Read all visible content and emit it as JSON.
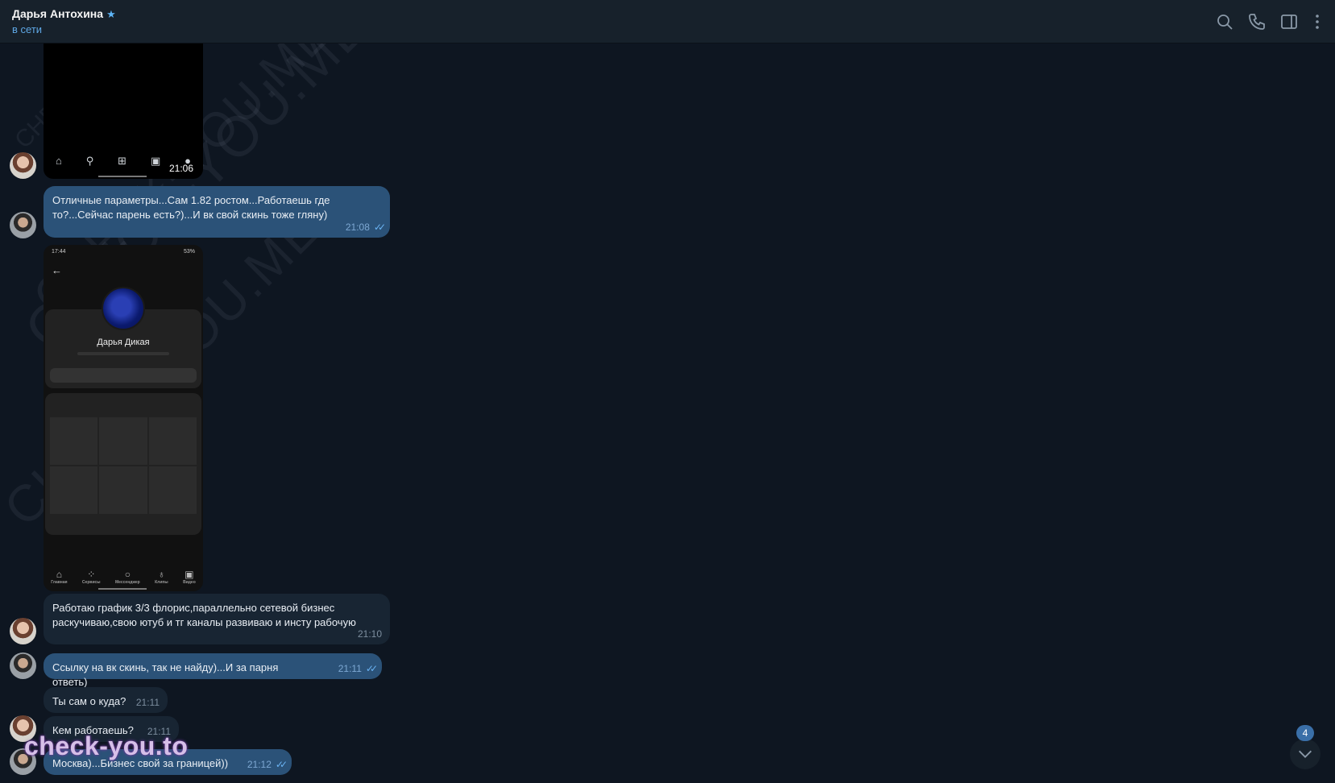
{
  "header": {
    "name": "Дарья Антохина",
    "status": "в сети",
    "icons": [
      "search-icon",
      "phone-icon",
      "sidebar-icon",
      "more-icon"
    ]
  },
  "watermark": {
    "text": "CHECK-YOU.ME",
    "bottom_text": "check-you.to"
  },
  "messages": [
    {
      "type": "image",
      "from": "her",
      "time": "21:06"
    },
    {
      "type": "text",
      "from": "him",
      "text": "Отличные параметры...Сам 1.82 ростом...Работаешь где то?...Сейчас парень есть?)...И вк свой скинь тоже гляну)",
      "time": "21:08"
    },
    {
      "type": "image",
      "from": "her",
      "profile_name": "Дарья Дикая",
      "status_time": "17:44",
      "battery": "53%",
      "nav": [
        "Главная",
        "Сервисы",
        "Мессенджер",
        "Клипы",
        "Видео"
      ]
    },
    {
      "type": "text",
      "from": "her",
      "text": "Работаю график 3/3 флорис,параллельно сетевой бизнес раскучиваю,свою ютуб и тг каналы развиваю и инсту рабочую",
      "time": "21:10"
    },
    {
      "type": "text",
      "from": "him",
      "text": "Ссылку на вк скинь, так не найду)...И за парня ответь)",
      "time": "21:11"
    },
    {
      "type": "text",
      "from": "her",
      "text": "Ты сам о куда?",
      "time": "21:11"
    },
    {
      "type": "text",
      "from": "her",
      "text": "Кем работаешь?",
      "time": "21:11"
    },
    {
      "type": "text",
      "from": "him",
      "text": "Москва)...Бизнес свой за границей))",
      "time": "21:12"
    }
  ],
  "scroll": {
    "unread": "4"
  }
}
